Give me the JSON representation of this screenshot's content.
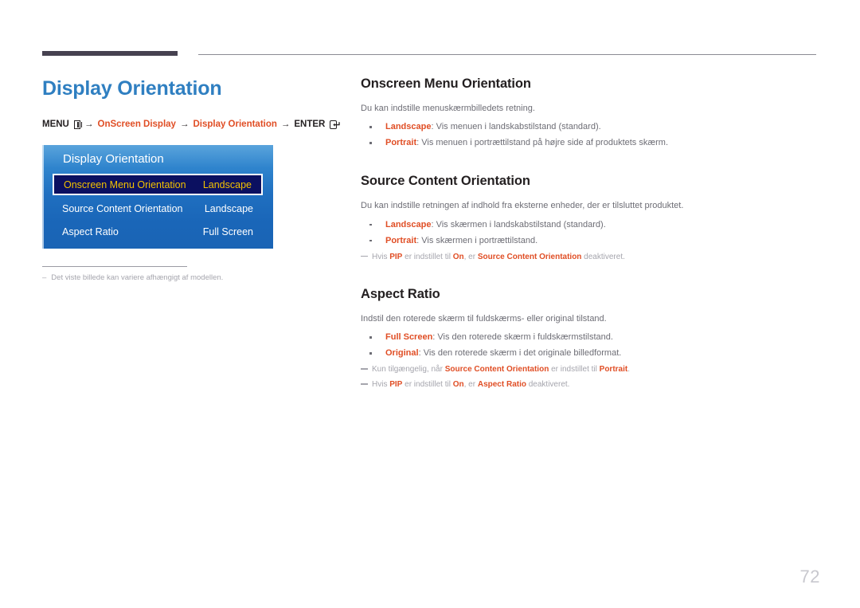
{
  "page": {
    "title": "Display Orientation",
    "number": "72"
  },
  "breadcrumb": {
    "menu_label": "MENU",
    "menu_icon": "menu-grid-icon",
    "arrow": "→",
    "step1": "OnScreen Display",
    "step2": "Display Orientation",
    "enter_label": "ENTER",
    "enter_icon": "enter-key-icon"
  },
  "osd": {
    "title": "Display Orientation",
    "rows": [
      {
        "label": "Onscreen Menu Orientation",
        "value": "Landscape",
        "selected": true
      },
      {
        "label": "Source Content Orientation",
        "value": "Landscape",
        "selected": false
      },
      {
        "label": "Aspect Ratio",
        "value": "Full Screen",
        "selected": false
      }
    ]
  },
  "left_note": {
    "dash": "–",
    "text": "Det viste billede kan variere afhængigt af modellen."
  },
  "sections": [
    {
      "title": "Onscreen Menu Orientation",
      "intro": "Du kan indstille menuskærmbilledets retning.",
      "bullets": [
        {
          "term": "Landscape",
          "sep": ": ",
          "text": "Vis menuen i landskabstilstand (standard)."
        },
        {
          "term": "Portrait",
          "sep": ": ",
          "text": "Vis menuen i portrættilstand på højre side af produktets skærm."
        }
      ],
      "notes": []
    },
    {
      "title": "Source Content Orientation",
      "intro": "Du kan indstille retningen af indhold fra eksterne enheder, der er tilsluttet produktet.",
      "bullets": [
        {
          "term": "Landscape",
          "sep": ": ",
          "text": "Vis skærmen i landskabstilstand (standard)."
        },
        {
          "term": "Portrait",
          "sep": ": ",
          "text": "Vis skærmen i portrættilstand."
        }
      ],
      "notes": [
        {
          "parts": [
            {
              "t": "Hvis ",
              "b": false
            },
            {
              "t": "PIP",
              "b": true
            },
            {
              "t": " er indstillet til ",
              "b": false
            },
            {
              "t": "On",
              "b": true
            },
            {
              "t": ", er ",
              "b": false
            },
            {
              "t": "Source Content Orientation",
              "b": true
            },
            {
              "t": " deaktiveret.",
              "b": false
            }
          ]
        }
      ]
    },
    {
      "title": "Aspect Ratio",
      "intro": "Indstil den roterede skærm til fuldskærms- eller original tilstand.",
      "bullets": [
        {
          "term": "Full Screen",
          "sep": ": ",
          "text": "Vis den roterede skærm i fuldskærmstilstand."
        },
        {
          "term": "Original",
          "sep": ": ",
          "text": "Vis den roterede skærm i det originale billedformat."
        }
      ],
      "notes": [
        {
          "parts": [
            {
              "t": "Kun tilgængelig, når ",
              "b": false
            },
            {
              "t": "Source Content Orientation",
              "b": true
            },
            {
              "t": " er indstillet til ",
              "b": false
            },
            {
              "t": "Portrait",
              "b": true
            },
            {
              "t": ".",
              "b": false
            }
          ]
        },
        {
          "parts": [
            {
              "t": "Hvis ",
              "b": false
            },
            {
              "t": "PIP",
              "b": true
            },
            {
              "t": " er indstillet til ",
              "b": false
            },
            {
              "t": "On",
              "b": true
            },
            {
              "t": ", er ",
              "b": false
            },
            {
              "t": "Aspect Ratio",
              "b": true
            },
            {
              "t": " deaktiveret.",
              "b": false
            }
          ]
        }
      ]
    }
  ],
  "colors": {
    "title_blue": "#2f7fc1",
    "accent_orange": "#e04e25",
    "osd_highlight_bg": "#0b1060",
    "osd_highlight_text": "#f2c200",
    "rule_dark": "#464150",
    "body_gray": "#6d6d75",
    "note_gray": "#a5a5ad"
  }
}
